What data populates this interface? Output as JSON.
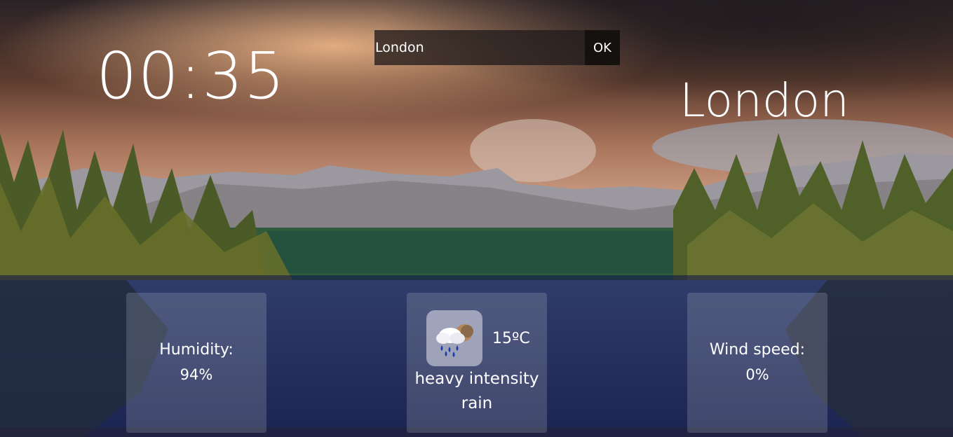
{
  "search": {
    "value": "London",
    "button_label": "OK"
  },
  "clock": {
    "time": "00:35"
  },
  "location": {
    "city": "London"
  },
  "humidity": {
    "label": "Humidity:",
    "value": "94%"
  },
  "weather": {
    "icon": "heavy-rain-cloud-icon",
    "temperature": "15ºC",
    "description": "heavy intensity rain"
  },
  "wind": {
    "label": "Wind speed:",
    "value": "0%"
  },
  "colors": {
    "panel_overlay": "#0c124e",
    "card_background": "#ffffff",
    "text": "#ffffff",
    "search_button": "#14110f"
  }
}
